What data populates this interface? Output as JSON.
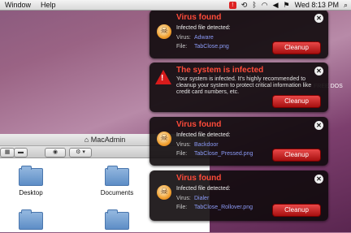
{
  "menubar": {
    "items": [
      "Window",
      "Help"
    ],
    "clock": "Wed 8:13 PM"
  },
  "finder": {
    "title": "MacAdmin",
    "folders": [
      "Desktop",
      "Documents"
    ]
  },
  "popups": [
    {
      "title": "Virus found",
      "sub": "Infected file detected:",
      "rows": [
        [
          "Virus:",
          "Adware"
        ],
        [
          "File:",
          "TabClose.png"
        ]
      ],
      "button": "Cleanup"
    },
    {
      "title": "The system is infected",
      "message": "Your system is infected. It's highly recommended to cleanup your system to protect critical information like credit card numbers, etc.",
      "button": "Cleanup"
    },
    {
      "title": "Virus found",
      "sub": "Infected file detected:",
      "rows": [
        [
          "Virus:",
          "Backdoor"
        ],
        [
          "File:",
          "TabClose_Pressed.png"
        ]
      ],
      "button": "Cleanup"
    },
    {
      "title": "Virus found",
      "sub": "Infected file detected:",
      "rows": [
        [
          "Virus:",
          "Dialer"
        ],
        [
          "File:",
          "TabClose_Rollover.png"
        ]
      ],
      "button": "Cleanup"
    }
  ],
  "ghost": "X",
  "ghost2": "FREE DOS"
}
